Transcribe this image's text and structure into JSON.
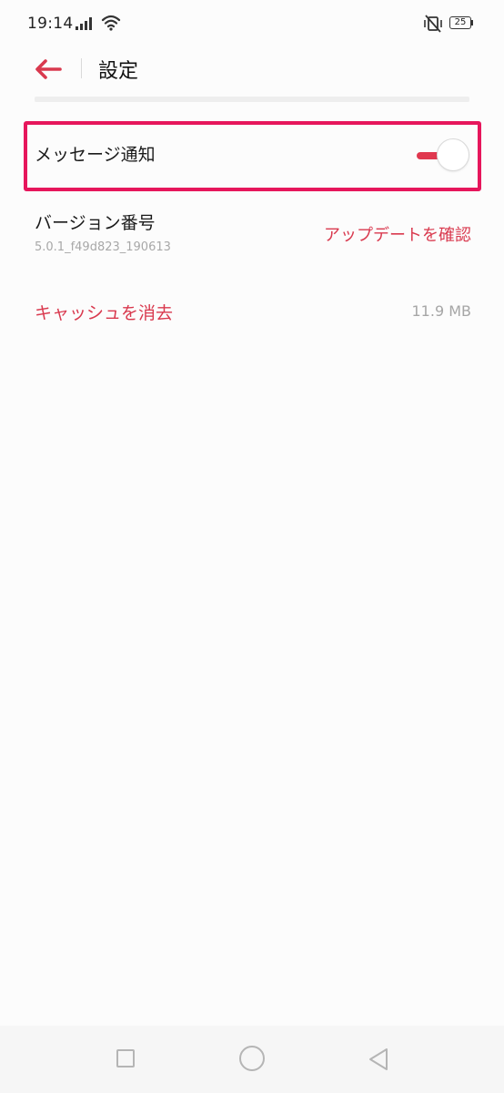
{
  "status_bar": {
    "time": "19:14",
    "battery_level": "25",
    "icons": [
      "signal-icon",
      "wifi-icon",
      "vibrate-off-icon",
      "battery-icon"
    ]
  },
  "header": {
    "title": "設定",
    "back_icon": "back-arrow-icon"
  },
  "settings": {
    "notification": {
      "label": "メッセージ通知",
      "enabled": true
    },
    "version": {
      "label": "バージョン番号",
      "number": "5.0.1_f49d823_190613",
      "update_label": "アップデートを確認"
    },
    "cache": {
      "label": "キャッシュを消去",
      "size": "11.9 MB"
    }
  },
  "colors": {
    "accent": "#d9394e",
    "highlight_frame": "#e6165c",
    "toggle_on": "#e0384f"
  },
  "nav_bar": {
    "icons": [
      "recent-apps-icon",
      "home-icon",
      "back-icon"
    ]
  }
}
